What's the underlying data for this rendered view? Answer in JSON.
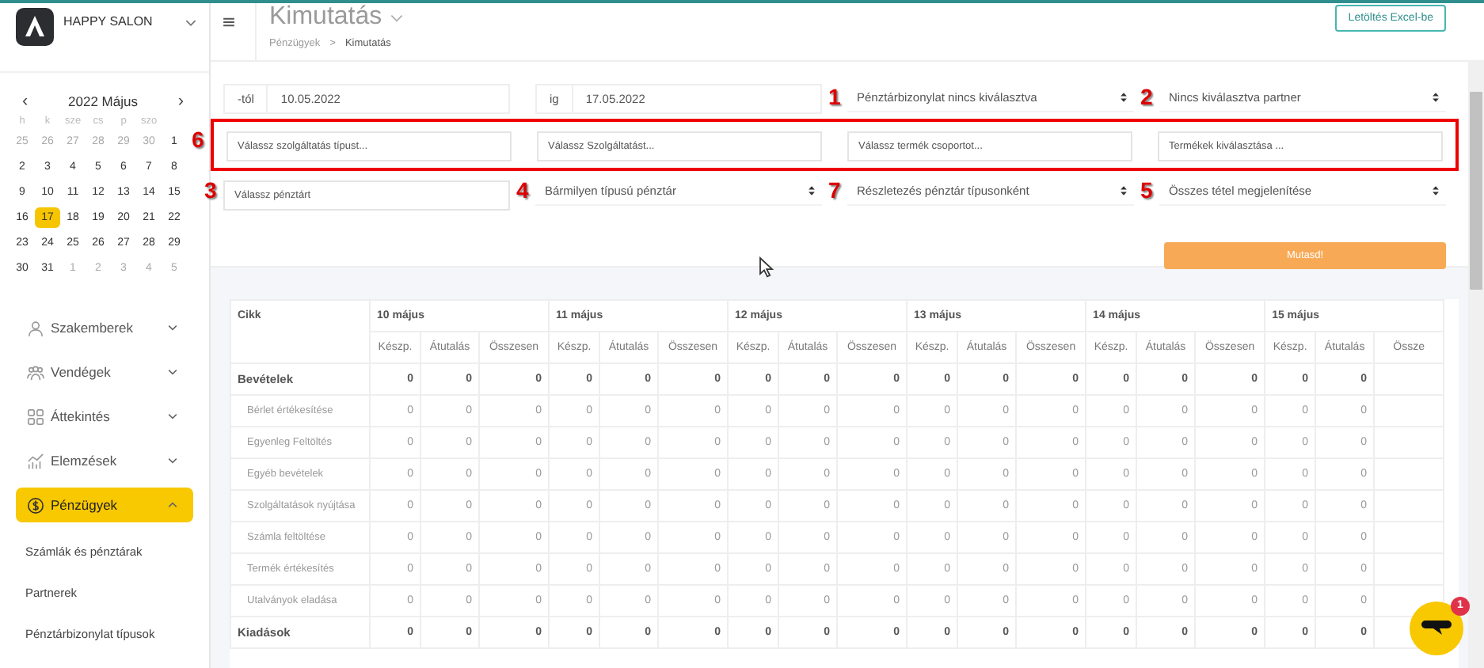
{
  "sidebar": {
    "brand": "HAPPY SALON",
    "calendar": {
      "title": "2022 Május",
      "prev": "‹",
      "next": "›",
      "weekdays": [
        "h",
        "k",
        "sze",
        "cs",
        "p",
        "szo"
      ],
      "weeks": [
        [
          {
            "label": "25",
            "outside": true,
            "selected": false
          },
          {
            "label": "26",
            "outside": true,
            "selected": false
          },
          {
            "label": "27",
            "outside": true,
            "selected": false
          },
          {
            "label": "28",
            "outside": true,
            "selected": false
          },
          {
            "label": "29",
            "outside": true,
            "selected": false
          },
          {
            "label": "30",
            "outside": true,
            "selected": false
          },
          {
            "label": "1",
            "outside": false,
            "selected": false
          }
        ],
        [
          {
            "label": "2",
            "outside": false,
            "selected": false
          },
          {
            "label": "3",
            "outside": false,
            "selected": false
          },
          {
            "label": "4",
            "outside": false,
            "selected": false
          },
          {
            "label": "5",
            "outside": false,
            "selected": false
          },
          {
            "label": "6",
            "outside": false,
            "selected": false
          },
          {
            "label": "7",
            "outside": false,
            "selected": false
          },
          {
            "label": "8",
            "outside": false,
            "selected": false
          }
        ],
        [
          {
            "label": "9",
            "outside": false,
            "selected": false
          },
          {
            "label": "10",
            "outside": false,
            "selected": false
          },
          {
            "label": "11",
            "outside": false,
            "selected": false
          },
          {
            "label": "12",
            "outside": false,
            "selected": false
          },
          {
            "label": "13",
            "outside": false,
            "selected": false
          },
          {
            "label": "14",
            "outside": false,
            "selected": false
          },
          {
            "label": "15",
            "outside": false,
            "selected": false
          }
        ],
        [
          {
            "label": "16",
            "outside": false,
            "selected": false
          },
          {
            "label": "17",
            "outside": false,
            "selected": true
          },
          {
            "label": "18",
            "outside": false,
            "selected": false
          },
          {
            "label": "19",
            "outside": false,
            "selected": false
          },
          {
            "label": "20",
            "outside": false,
            "selected": false
          },
          {
            "label": "21",
            "outside": false,
            "selected": false
          },
          {
            "label": "22",
            "outside": false,
            "selected": false
          }
        ],
        [
          {
            "label": "23",
            "outside": false,
            "selected": false
          },
          {
            "label": "24",
            "outside": false,
            "selected": false
          },
          {
            "label": "25",
            "outside": false,
            "selected": false
          },
          {
            "label": "26",
            "outside": false,
            "selected": false
          },
          {
            "label": "27",
            "outside": false,
            "selected": false
          },
          {
            "label": "28",
            "outside": false,
            "selected": false
          },
          {
            "label": "29",
            "outside": false,
            "selected": false
          }
        ],
        [
          {
            "label": "30",
            "outside": false,
            "selected": false
          },
          {
            "label": "31",
            "outside": false,
            "selected": false
          },
          {
            "label": "1",
            "outside": true,
            "selected": false
          },
          {
            "label": "2",
            "outside": true,
            "selected": false
          },
          {
            "label": "3",
            "outside": true,
            "selected": false
          },
          {
            "label": "4",
            "outside": true,
            "selected": false
          },
          {
            "label": "5",
            "outside": true,
            "selected": false
          }
        ]
      ]
    },
    "nav": [
      {
        "label": "Szakemberek",
        "selected": false,
        "expanded": false
      },
      {
        "label": "Vendégek",
        "selected": false,
        "expanded": false
      },
      {
        "label": "Áttekintés",
        "selected": false,
        "expanded": false
      },
      {
        "label": "Elemzések",
        "selected": false,
        "expanded": false
      },
      {
        "label": "Pénzügyek",
        "selected": true,
        "expanded": true
      }
    ],
    "subitems": [
      "Számlák és pénztárak",
      "Partnerek",
      "Pénztárbizonylat típusok"
    ]
  },
  "header": {
    "title": "Kimutatás",
    "breadcrumb": [
      "Pénzügyek",
      "Kimutatás"
    ],
    "separator": ">",
    "export_button": "Letöltés Excel-be"
  },
  "filters": [
    {
      "highlighted": false,
      "items": [
        {
          "kind": "date",
          "prefix": "-tól",
          "value": "10.05.2022"
        },
        {
          "kind": "date",
          "prefix": "ig",
          "value": "17.05.2022"
        },
        {
          "kind": "select",
          "value": "Pénztárbizonylat nincs kiválasztva",
          "marker": "1"
        },
        {
          "kind": "select",
          "value": "Nincs kiválasztva partner",
          "marker": "2"
        }
      ]
    },
    {
      "highlighted": true,
      "marker": "6",
      "items": [
        {
          "kind": "input",
          "placeholder": "Válassz szolgáltatás típust..."
        },
        {
          "kind": "input",
          "placeholder": "Válassz Szolgáltatást..."
        },
        {
          "kind": "input",
          "placeholder": "Válassz termék csoportot..."
        },
        {
          "kind": "input",
          "placeholder": "Termékek kiválasztása ..."
        }
      ]
    },
    {
      "highlighted": false,
      "items": [
        {
          "kind": "input",
          "placeholder": "Válassz pénztárt",
          "marker": "3"
        },
        {
          "kind": "select",
          "value": "Bármilyen típusú pénztár",
          "marker": "4"
        },
        {
          "kind": "select",
          "value": "Részletezés pénztár típusonként",
          "marker": "7"
        },
        {
          "kind": "select",
          "value": "Összes tétel megjelenítése",
          "marker": "5"
        }
      ]
    }
  ],
  "show_button": "Mutasd!",
  "table": {
    "first_column": "Cikk",
    "days": [
      "10 május",
      "11 május",
      "12 május",
      "13 május",
      "14 május",
      "15 május"
    ],
    "subcolumns": [
      "Készp.",
      "Átutalás",
      "Összesen",
      "Készp.",
      "Átutalás",
      "Összesen",
      "Készp.",
      "Átutalás",
      "Összesen",
      "Készp.",
      "Átutalás",
      "Összesen",
      "Készp.",
      "Átutalás",
      "Összesen",
      "Készp.",
      "Átutalás",
      "Össze"
    ],
    "rows": [
      {
        "label": "Bevételek",
        "bold": true,
        "values": [
          "0",
          "0",
          "0",
          "0",
          "0",
          "0",
          "0",
          "0",
          "0",
          "0",
          "0",
          "0",
          "0",
          "0",
          "0",
          "0",
          "0"
        ]
      },
      {
        "label": "Bérlet értékesítése",
        "bold": false,
        "values": [
          "0",
          "0",
          "0",
          "0",
          "0",
          "0",
          "0",
          "0",
          "0",
          "0",
          "0",
          "0",
          "0",
          "0",
          "0",
          "0",
          "0"
        ]
      },
      {
        "label": "Egyenleg Feltöltés",
        "bold": false,
        "values": [
          "0",
          "0",
          "0",
          "0",
          "0",
          "0",
          "0",
          "0",
          "0",
          "0",
          "0",
          "0",
          "0",
          "0",
          "0",
          "0",
          "0"
        ]
      },
      {
        "label": "Egyéb bevételek",
        "bold": false,
        "values": [
          "0",
          "0",
          "0",
          "0",
          "0",
          "0",
          "0",
          "0",
          "0",
          "0",
          "0",
          "0",
          "0",
          "0",
          "0",
          "0",
          "0"
        ]
      },
      {
        "label": "Szolgáltatások nyújtása",
        "bold": false,
        "values": [
          "0",
          "0",
          "0",
          "0",
          "0",
          "0",
          "0",
          "0",
          "0",
          "0",
          "0",
          "0",
          "0",
          "0",
          "0",
          "0",
          "0"
        ]
      },
      {
        "label": "Számla feltöltése",
        "bold": false,
        "values": [
          "0",
          "0",
          "0",
          "0",
          "0",
          "0",
          "0",
          "0",
          "0",
          "0",
          "0",
          "0",
          "0",
          "0",
          "0",
          "0",
          "0"
        ]
      },
      {
        "label": "Termék értékesítés",
        "bold": false,
        "values": [
          "0",
          "0",
          "0",
          "0",
          "0",
          "0",
          "0",
          "0",
          "0",
          "0",
          "0",
          "0",
          "0",
          "0",
          "0",
          "0",
          "0"
        ]
      },
      {
        "label": "Utalványok eladása",
        "bold": false,
        "values": [
          "0",
          "0",
          "0",
          "0",
          "0",
          "0",
          "0",
          "0",
          "0",
          "0",
          "0",
          "0",
          "0",
          "0",
          "0",
          "0",
          "0"
        ]
      },
      {
        "label": "Kiadások",
        "bold": true,
        "values": [
          "0",
          "0",
          "0",
          "0",
          "0",
          "0",
          "0",
          "0",
          "0",
          "0",
          "0",
          "0",
          "0",
          "0",
          "0",
          "0",
          "0"
        ]
      }
    ]
  },
  "chat": {
    "badge": "1"
  }
}
